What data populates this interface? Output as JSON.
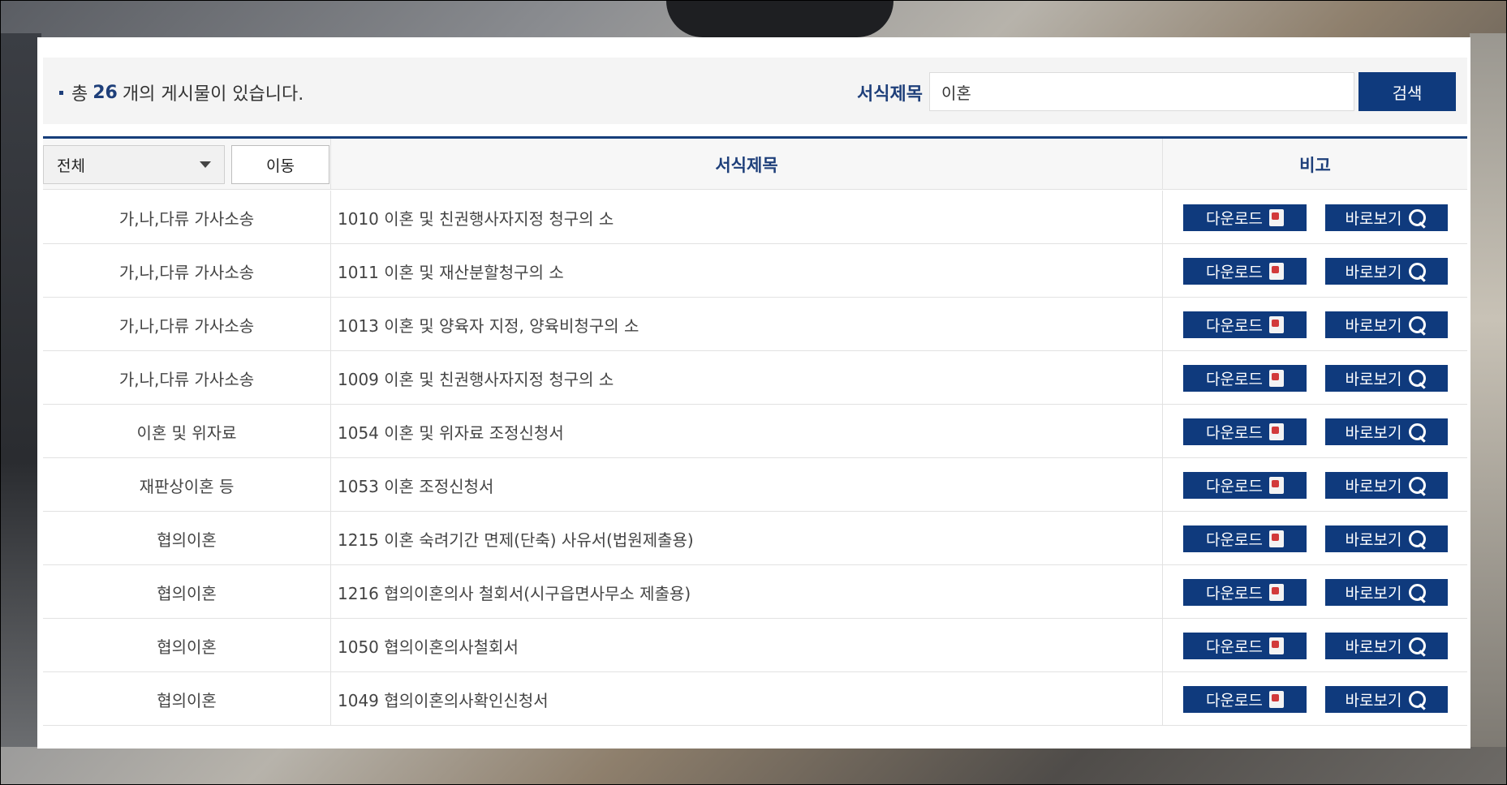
{
  "search": {
    "count_prefix": "총",
    "count": "26",
    "count_suffix": "개의 게시물이 있습니다.",
    "label": "서식제목",
    "value": "이혼",
    "button": "검색"
  },
  "header": {
    "category_select": "전체",
    "move_button": "이동",
    "col_title": "서식제목",
    "col_note": "비고"
  },
  "buttons": {
    "download": "다운로드",
    "view": "바로보기"
  },
  "rows": [
    {
      "category": "가,나,다류 가사소송",
      "title": "1010 이혼 및 친권행사자지정 청구의 소"
    },
    {
      "category": "가,나,다류 가사소송",
      "title": "1011 이혼 및 재산분할청구의 소"
    },
    {
      "category": "가,나,다류 가사소송",
      "title": "1013 이혼 및 양육자 지정, 양육비청구의 소"
    },
    {
      "category": "가,나,다류 가사소송",
      "title": "1009 이혼 및 친권행사자지정 청구의 소"
    },
    {
      "category": "이혼 및 위자료",
      "title": "1054 이혼 및 위자료 조정신청서"
    },
    {
      "category": "재판상이혼 등",
      "title": "1053 이혼 조정신청서"
    },
    {
      "category": "협의이혼",
      "title": "1215 이혼 숙려기간 면제(단축) 사유서(법원제출용)"
    },
    {
      "category": "협의이혼",
      "title": "1216 협의이혼의사 철회서(시구읍면사무소 제출용)"
    },
    {
      "category": "협의이혼",
      "title": "1050 협의이혼의사철회서"
    },
    {
      "category": "협의이혼",
      "title": "1049 협의이혼의사확인신청서"
    }
  ],
  "colors": {
    "primary": "#0f3a7d",
    "accent_text": "#1e3f7a"
  },
  "icons": [
    "pdf-icon",
    "magnifier-icon",
    "chevron-down-icon"
  ]
}
